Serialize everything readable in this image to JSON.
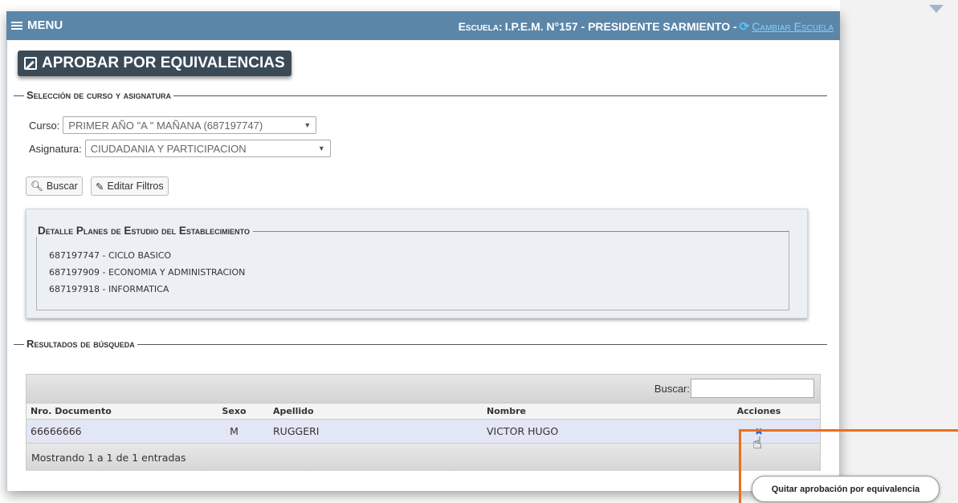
{
  "topbar": {
    "menu_label": "MENU",
    "school_prefix": "Escuela:",
    "school_name": "I.P.E.M. N°157 - PRESIDENTE SARMIENTO -",
    "change_school_label": "Cambiar Escuela"
  },
  "page_title": "APROBAR POR EQUIVALENCIAS",
  "selection": {
    "legend": "Selección de curso y asignatura",
    "curso_label": "Curso:",
    "curso_value": "PRIMER AÑO \"A \" MAÑANA (687197747)",
    "asignatura_label": "Asignatura:",
    "asignatura_value": "CIUDADANIA Y PARTICIPACION",
    "search_button": "Buscar",
    "edit_filters_button": "Editar Filtros"
  },
  "plans": {
    "legend": "Detalle Planes de Estudio del Establecimiento",
    "items": [
      "687197747 - CICLO BASICO",
      "687197909 - ECONOMIA Y ADMINISTRACION",
      "687197918 - INFORMATICA"
    ]
  },
  "results": {
    "legend": "Resultados de búsqueda",
    "search_label": "Buscar:",
    "search_value": "",
    "columns": [
      "Nro. Documento",
      "Sexo",
      "Apellido",
      "Nombre",
      "Acciones"
    ],
    "rows": [
      {
        "documento": "66666666",
        "sexo": "M",
        "apellido": "RUGGERI",
        "nombre": "VICTOR HUGO"
      }
    ],
    "footer": "Mostrando 1 a 1 de 1 entradas",
    "action_icon": "x-icon"
  },
  "tooltip": "Quitar aprobación por equivalencia",
  "colors": {
    "topbar": "#5b86a8",
    "title_button": "#3b4a57",
    "highlight": "#e8701f",
    "row_bg": "#e2e6f5"
  }
}
